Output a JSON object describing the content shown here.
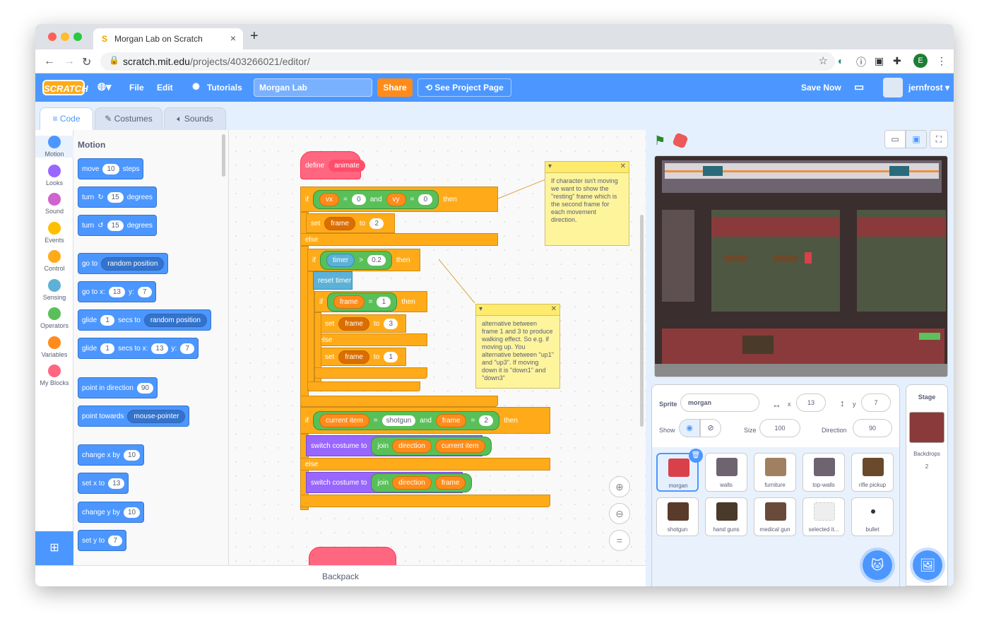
{
  "browser": {
    "tab_title": "Morgan Lab on Scratch",
    "url_host": "scratch.mit.edu",
    "url_path": "/projects/403266021/editor/",
    "profile_initial": "E"
  },
  "menu": {
    "logo": "SCRATCH",
    "file": "File",
    "edit": "Edit",
    "tutorials": "Tutorials",
    "project_title": "Morgan Lab",
    "share": "Share",
    "see_project": "See Project Page",
    "save_now": "Save Now",
    "username": "jernfrost"
  },
  "tabs": {
    "code": "Code",
    "costumes": "Costumes",
    "sounds": "Sounds"
  },
  "categories": [
    {
      "label": "Motion",
      "color": "#4c97ff"
    },
    {
      "label": "Looks",
      "color": "#9966ff"
    },
    {
      "label": "Sound",
      "color": "#cf63cf"
    },
    {
      "label": "Events",
      "color": "#ffbf00"
    },
    {
      "label": "Control",
      "color": "#ffab19"
    },
    {
      "label": "Sensing",
      "color": "#5cb1d6"
    },
    {
      "label": "Operators",
      "color": "#59c059"
    },
    {
      "label": "Variables",
      "color": "#ff8c1a"
    },
    {
      "label": "My Blocks",
      "color": "#ff6680"
    }
  ],
  "palette": {
    "heading": "Motion",
    "move": {
      "a": "move",
      "v": "10",
      "b": "steps"
    },
    "turn_cw": {
      "a": "turn",
      "v": "15",
      "b": "degrees"
    },
    "turn_ccw": {
      "a": "turn",
      "v": "15",
      "b": "degrees"
    },
    "goto": {
      "a": "go to",
      "d": "random position"
    },
    "goto_xy": {
      "a": "go to x:",
      "x": "13",
      "b": "y:",
      "y": "7"
    },
    "glide": {
      "a": "glide",
      "v": "1",
      "b": "secs to",
      "d": "random position"
    },
    "glide_xy": {
      "a": "glide",
      "v": "1",
      "b": "secs to x:",
      "x": "13",
      "c": "y:",
      "y": "7"
    },
    "point_dir": {
      "a": "point in direction",
      "v": "90"
    },
    "point_towards": {
      "a": "point towards",
      "d": "mouse-pointer"
    },
    "change_x": {
      "a": "change x by",
      "v": "10"
    },
    "set_x": {
      "a": "set x to",
      "v": "13"
    },
    "change_y": {
      "a": "change y by",
      "v": "10"
    },
    "set_y": {
      "a": "set y to",
      "v": "7"
    }
  },
  "script": {
    "define": "define",
    "animate": "animate",
    "if": "if",
    "then": "then",
    "else": "else",
    "and": "and",
    "eq": "=",
    "gt": ">",
    "to": "to",
    "set": "set",
    "vx": "vx",
    "vy": "vy",
    "zero": "0",
    "frame": "frame",
    "two": "2",
    "timer": "timer",
    "timer_val": "0.2",
    "reset_timer": "reset timer",
    "one": "1",
    "three": "3",
    "current_item": "current item",
    "shotgun": "shotgun",
    "switch_costume": "switch costume to",
    "join": "join",
    "direction": "direction"
  },
  "notes": [
    {
      "text": "If character isn't moving we want to show the \"resting\" frame which is the second frame for each movement direction."
    },
    {
      "text": "alternative between frame 1 and 3 to produce walking effect. So e.g. if moving up. You alternative between \"up1\" and \"up3\". If moving down it is \"down1\" and \"down3\""
    }
  ],
  "backpack": "Backpack",
  "sprite_info": {
    "sprite_label": "Sprite",
    "name": "morgan",
    "x_label": "x",
    "x": "13",
    "y_label": "y",
    "y": "7",
    "show_label": "Show",
    "size_label": "Size",
    "size": "100",
    "direction_label": "Direction",
    "direction": "90"
  },
  "sprites": [
    "morgan",
    "walls",
    "furniture",
    "top-walls",
    "rifle pickup",
    "shotgun",
    "hand guns",
    "medical gun",
    "selected it...",
    "bullet"
  ],
  "stage_panel": {
    "title": "Stage",
    "backdrops_label": "Backdrops",
    "backdrops_count": "2"
  }
}
